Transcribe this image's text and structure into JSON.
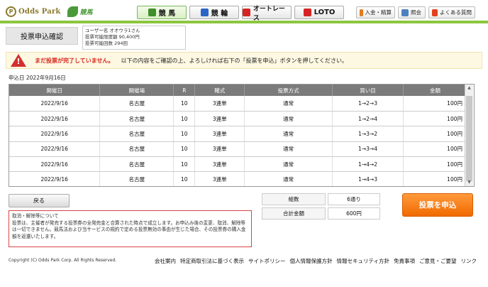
{
  "brand": {
    "logo_text": "Odds Park",
    "keiba_text": "競馬",
    "logo_letter": "P"
  },
  "tabs": [
    {
      "label": "競 馬",
      "color": "#3f8f2a"
    },
    {
      "label": "競 輪",
      "color": "#2a64c6"
    },
    {
      "label": "オートレース",
      "color": "#d62424"
    },
    {
      "label": "LOTO",
      "color": "#d62424"
    }
  ],
  "utility": [
    {
      "label": "入金・精算",
      "color": "#e27b1c"
    },
    {
      "label": "照会",
      "color": "#4f7fc0"
    },
    {
      "label": "よくある質問",
      "color": "#e2401c"
    }
  ],
  "title": "投票申込確認",
  "user": {
    "line1": "ユーザー名 オオウラ1さん",
    "line2": "投票可能限度額 90,400円",
    "line3": "投票可能回数 294回"
  },
  "warning": {
    "icon_mark": "!",
    "strong": "まだ投票が完了していません。",
    "text": "以下の内容をご確認の上、よろしければ右下の「投票を申込」ボタンを押してください。"
  },
  "date_line": "申込日 2022年9月16日",
  "table": {
    "headers": [
      "開催日",
      "開催場",
      "R",
      "賭式",
      "投票方式",
      "買い目",
      "金額"
    ],
    "rows": [
      [
        "2022/9/16",
        "名古屋",
        "10",
        "3連単",
        "通常",
        "1→2→3",
        "100円"
      ],
      [
        "2022/9/16",
        "名古屋",
        "10",
        "3連単",
        "通常",
        "1→2→4",
        "100円"
      ],
      [
        "2022/9/16",
        "名古屋",
        "10",
        "3連単",
        "通常",
        "1→3→2",
        "100円"
      ],
      [
        "2022/9/16",
        "名古屋",
        "10",
        "3連単",
        "通常",
        "1→3→4",
        "100円"
      ],
      [
        "2022/9/16",
        "名古屋",
        "10",
        "3連単",
        "通常",
        "1→4→2",
        "100円"
      ],
      [
        "2022/9/16",
        "名古屋",
        "10",
        "3連単",
        "通常",
        "1→4→3",
        "100円"
      ]
    ]
  },
  "back_label": "戻る",
  "notice": {
    "title": "取消・解除等について",
    "body": "投票は、主催者が発売する投票券の全発売金と合算された時点で成立します。お申込み後の変更、取消、解除等は一切できません。競馬法および当サービスの規約で定める投票無効の事由が生じた場合、その投票券の購入金額を返還いたします。"
  },
  "summary": {
    "count_label": "組数",
    "count_value": "6通り",
    "total_label": "合計金額",
    "total_value": "600円"
  },
  "submit_label": "投票を申込",
  "copyright": "Copyright (C) Odds Park Corp. All Rights Reserved.",
  "footer_links": [
    "会社案内",
    "特定商取引法に基づく表示",
    "サイトポリシー",
    "個人情報保護方針",
    "情報セキュリティ方針",
    "免責事項",
    "ご意見・ご要望",
    "リンク"
  ],
  "scroll": {
    "up": "▲",
    "down": "▼"
  }
}
